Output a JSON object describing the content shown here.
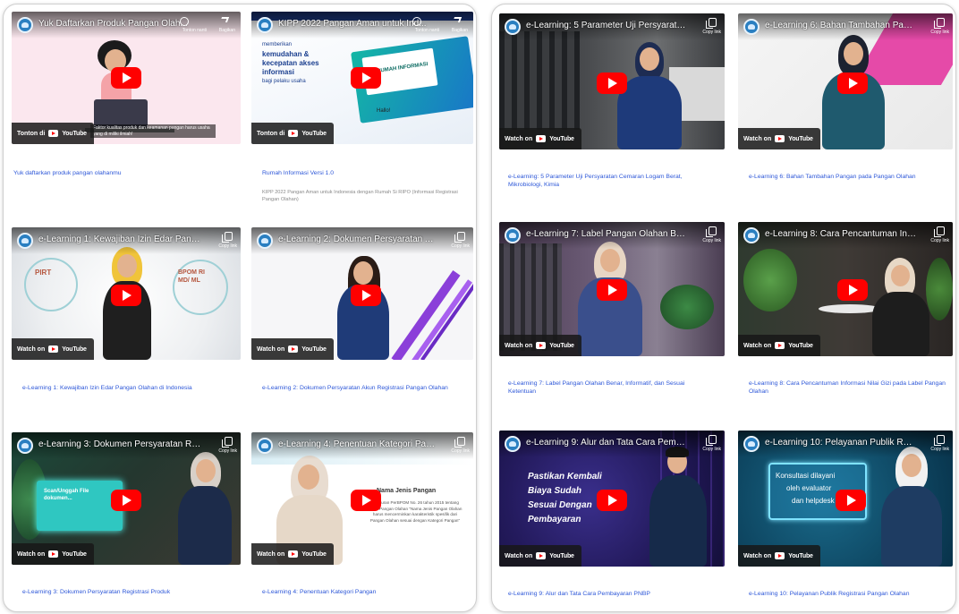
{
  "left_panel": {
    "cards": [
      {
        "video_title": "Yuk Daftarkan Produk Pangan Olah...",
        "label": "Yuk daftarkan produk pangan olahanmu",
        "watch_on": "Tonton di",
        "platform": "YouTube",
        "topright_1": "Tonton nanti",
        "topright_2": "Bagikan",
        "caption": "Faktor kualitas produk dan keamanan pangan harus usaha yang di miliki ilmiah!"
      },
      {
        "video_title": "KIPP 2022 Pangan Aman untuk Ind...",
        "label": "Rumah Informasi Versi 1.0",
        "description": "KIPP 2022 Pangan Aman untuk Indonesia dengan Rumah Si RIPO (Informasi Registrasi Pangan Olahan)",
        "watch_on": "Tonton di",
        "platform": "YouTube",
        "topright_1": "Tonton nanti",
        "topright_2": "Bagikan",
        "slide_line_1": "memberikan",
        "slide_line_2": "kemudahan &",
        "slide_line_3": "kecepatan akses",
        "slide_line_4": "informasi",
        "slide_line_5": "bagi pelaku usaha",
        "slide_badge": "RUMAH INFORMASI",
        "slide_hello": "Hallo!"
      },
      {
        "video_title": "e-Learning 1: Kewajiban Izin Edar Pangan Olah...",
        "label": "e-Learning 1: Kewajiban Izin Edar Pangan Olahan di Indonesia",
        "watch_on": "Watch on",
        "platform": "YouTube",
        "copy": "Copy link",
        "bg_text_1": "PIRT",
        "bg_text_2": "BPOM RI MD/ ML"
      },
      {
        "video_title": "e-Learning 2: Dokumen Persyaratan Akun Regi...",
        "label": "e-Learning 2: Dokumen Persyaratan Akun Registrasi Pangan Olahan",
        "watch_on": "Watch on",
        "platform": "YouTube",
        "copy": "Copy link"
      },
      {
        "video_title": "e-Learning 3: Dokumen Persyaratan Registrasi...",
        "label": "e-Learning 3: Dokumen Persyaratan Registrasi Produk",
        "watch_on": "Watch on",
        "platform": "YouTube",
        "copy": "Copy link",
        "screen_text": "Scan/Unggah File dokumen..."
      },
      {
        "video_title": "e-Learning 4: Penentuan Kategori Pangan",
        "label": "e-Learning 4: Penentuan Kategori Pangan",
        "watch_on": "Watch on",
        "platform": "YouTube",
        "copy": "Copy link",
        "slide_heading": "Nama Jenis Pangan",
        "slide_body": "Peraturan PerBPOM No. 26 tahun 2015 tentang Label Pangan Olahan \"Nama Jenis Pangan Olahan harus mencerminkan karakteristik spesifik dari Pangan Olahan sesuai dengan Kategori Pangan\""
      }
    ]
  },
  "right_panel": {
    "cards": [
      {
        "video_title": "e-Learning: 5 Parameter Uji Persyaratan Cemar...",
        "label": "e-Learning: 5 Parameter Uji Persyaratan Cemaran Logam Berat, Mikrobiologi, Kimia",
        "watch_on": "Watch on",
        "platform": "YouTube",
        "copy": "Copy link"
      },
      {
        "video_title": "e-Learning 6: Bahan Tambahan Pangan pada P...",
        "label": "e-Learning 6: Bahan Tambahan Pangan pada Pangan Olahan",
        "watch_on": "Watch on",
        "platform": "YouTube",
        "copy": "Copy link"
      },
      {
        "video_title": "e-Learning 7: Label Pangan Olahan Benar, Infor...",
        "label": "e-Learning 7: Label Pangan Olahan Benar, Informatif, dan Sesuai Ketentuan",
        "watch_on": "Watch on",
        "platform": "YouTube",
        "copy": "Copy link"
      },
      {
        "video_title": "e-Learning 8: Cara Pencantuman Informasi Nil...",
        "label": "e-Learning 8: Cara Pencantuman Informasi Nilai Gizi pada Label Pangan Olahan",
        "watch_on": "Watch on",
        "platform": "YouTube",
        "copy": "Copy link"
      },
      {
        "video_title": "e-Learning 9: Alur dan Tata Cara Pembayaran ...",
        "label": "e-Learning 9: Alur dan Tata Cara Pembayaran PNBP",
        "watch_on": "Watch on",
        "platform": "YouTube",
        "copy": "Copy link",
        "slide_1": "Pastikan Kembali",
        "slide_2": "Biaya Sudah",
        "slide_3": "Sesuai Dengan",
        "slide_4": "Pembayaran"
      },
      {
        "video_title": "e-Learning 10: Pelayanan Publik Registrasi Pa...",
        "label": "e-Learning 10: Pelayanan Publik Registrasi Pangan Olahan",
        "watch_on": "Watch on",
        "platform": "YouTube",
        "copy": "Copy link",
        "box_1": "Konsultasi dilayani",
        "box_2": "oleh evaluator",
        "box_3": "dan helpdesk"
      }
    ]
  }
}
